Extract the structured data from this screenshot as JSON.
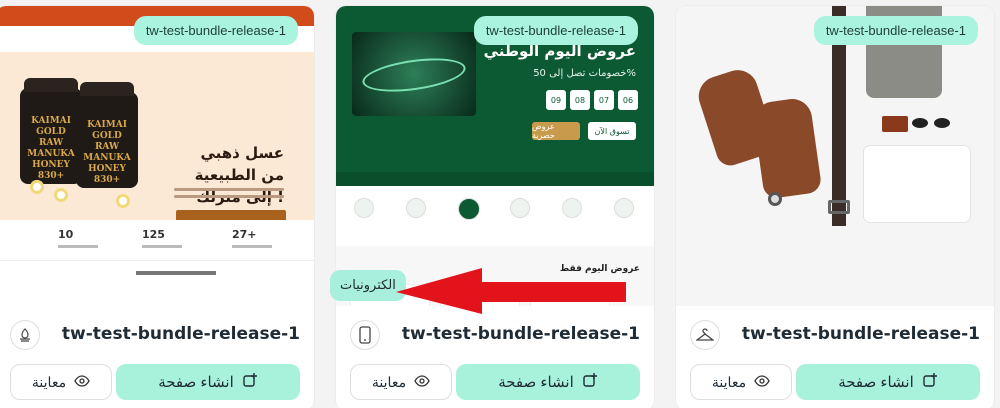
{
  "cards": [
    {
      "tag": "tw-test-bundle-release-1",
      "title": "tw-test-bundle-release-1",
      "create_label": "انشاء صفحة",
      "preview_label": "معاينة",
      "category_icon": "honey-category-icon",
      "thumb": {
        "headline": "عسل ذهبي من الطبيعية إلى منزلك !",
        "jar_label": "KAIMAI GOLD RAW MANUKA HONEY 830+",
        "stats": [
          "10",
          "125",
          "27+"
        ]
      }
    },
    {
      "tag": "tw-test-bundle-release-1",
      "title": "tw-test-bundle-release-1",
      "create_label": "انشاء صفحة",
      "preview_label": "معاينة",
      "category_icon": "phone-category-icon",
      "thumb": {
        "headline": "عروض اليوم الوطني",
        "sub": "خصومات تصل إلى 50%",
        "timer": [
          "09",
          "08",
          "07",
          "06"
        ],
        "btn_shop": "تسوق الآن",
        "btn_offers": "عروض حصرية",
        "deals_title": "عروض اليوم فقط"
      }
    },
    {
      "tag": "tw-test-bundle-release-1",
      "title": "tw-test-bundle-release-1",
      "create_label": "انشاء صفحة",
      "preview_label": "معاينة",
      "category_icon": "hanger-category-icon"
    }
  ],
  "tooltip": "الكترونيات",
  "colors": {
    "accent": "#a8f2dc",
    "arrow": "#e3131b",
    "electronics_green": "#0c5a33",
    "honey_orange": "#d24b1a"
  }
}
